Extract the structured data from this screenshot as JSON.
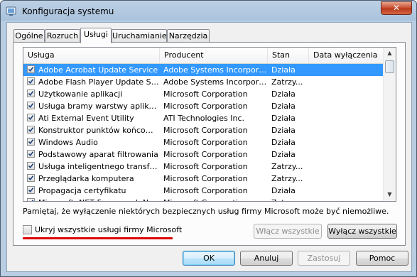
{
  "window": {
    "title": "Konfiguracja systemu",
    "title_icon": "system-config-icon",
    "close_icon": "close-icon"
  },
  "tabs": [
    {
      "label": "Ogólne"
    },
    {
      "label": "Rozruch"
    },
    {
      "label": "Usługi",
      "active": true
    },
    {
      "label": "Uruchamianie"
    },
    {
      "label": "Narzędzia"
    }
  ],
  "services_table": {
    "columns": [
      "Usługa",
      "Producent",
      "Stan",
      "Data wyłączenia"
    ],
    "rows": [
      {
        "checked": true,
        "name": "Adobe Acrobat Update Service",
        "vendor": "Adobe Systems Incorporated",
        "status": "Działa",
        "disabled_date": "",
        "selected": true
      },
      {
        "checked": true,
        "name": "Adobe Flash Player Update Service",
        "vendor": "Adobe Systems Incorporated",
        "status": "Zatrzy...",
        "disabled_date": ""
      },
      {
        "checked": true,
        "name": "Użytkowanie aplikacji",
        "vendor": "Microsoft Corporation",
        "status": "Działa",
        "disabled_date": ""
      },
      {
        "checked": true,
        "name": "Usługa bramy warstwy aplikacji",
        "vendor": "Microsoft Corporation",
        "status": "Działa",
        "disabled_date": ""
      },
      {
        "checked": true,
        "name": "Ati External Event Utility",
        "vendor": "ATI Technologies Inc.",
        "status": "Działa",
        "disabled_date": ""
      },
      {
        "checked": true,
        "name": "Konstruktor punktów końcowych...",
        "vendor": "Microsoft Corporation",
        "status": "Działa",
        "disabled_date": ""
      },
      {
        "checked": true,
        "name": "Windows Audio",
        "vendor": "Microsoft Corporation",
        "status": "Działa",
        "disabled_date": ""
      },
      {
        "checked": true,
        "name": "Podstawowy aparat filtrowania",
        "vendor": "Microsoft Corporation",
        "status": "Działa",
        "disabled_date": ""
      },
      {
        "checked": true,
        "name": "Usługa inteligentnego transferu ...",
        "vendor": "Microsoft Corporation",
        "status": "Zatrzy...",
        "disabled_date": ""
      },
      {
        "checked": true,
        "name": "Przeglądarka komputera",
        "vendor": "Microsoft Corporation",
        "status": "Zatrzy...",
        "disabled_date": ""
      },
      {
        "checked": true,
        "name": "Propagacja certyfikatu",
        "vendor": "Microsoft Corporation",
        "status": "Działa",
        "disabled_date": ""
      },
      {
        "checked": true,
        "name": "Microsoft .NET Framework NGEN...",
        "vendor": "Microsoft Corporation",
        "status": "Zatrzy...",
        "disabled_date": ""
      }
    ]
  },
  "note": "Pamiętaj, że wyłączenie niektórych bezpiecznych usług firmy Microsoft może być niemożliwe.",
  "hide_ms_checkbox": {
    "label": "Ukryj wszystkie usługi firmy Microsoft",
    "checked": false
  },
  "buttons": {
    "enable_all": "Włącz wszystkie",
    "disable_all": "Wyłącz wszystkie",
    "ok": "OK",
    "cancel": "Anuluj",
    "apply": "Zastosuj",
    "help": "Pomoc"
  },
  "colors": {
    "selection": "#3399ff",
    "annotation_underline": "#e00000",
    "titlebar": "#a9c2dc"
  }
}
